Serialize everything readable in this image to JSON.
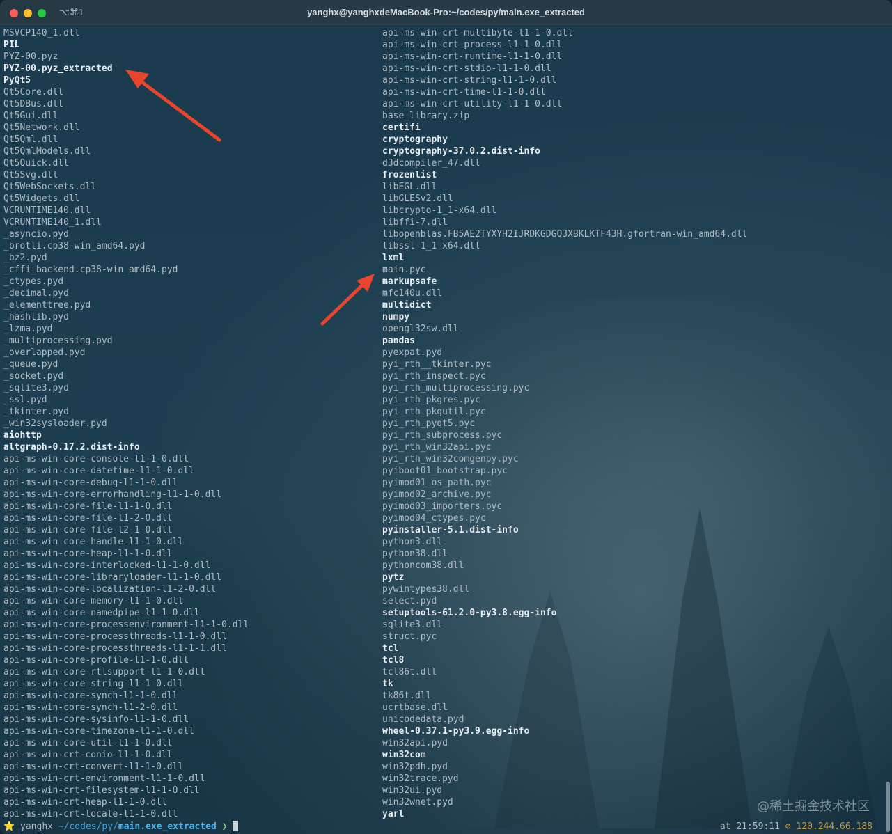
{
  "window": {
    "title": "yanghx@yanghxdeMacBook-Pro:~/codes/py/main.exe_extracted",
    "tab_shortcut": "⌥⌘1"
  },
  "listing": {
    "left_column": [
      {
        "name": "MSVCP140_1.dll",
        "dir": false
      },
      {
        "name": "PIL",
        "dir": true
      },
      {
        "name": "PYZ-00.pyz",
        "dir": false
      },
      {
        "name": "PYZ-00.pyz_extracted",
        "dir": true
      },
      {
        "name": "PyQt5",
        "dir": true
      },
      {
        "name": "Qt5Core.dll",
        "dir": false
      },
      {
        "name": "Qt5DBus.dll",
        "dir": false
      },
      {
        "name": "Qt5Gui.dll",
        "dir": false
      },
      {
        "name": "Qt5Network.dll",
        "dir": false
      },
      {
        "name": "Qt5Qml.dll",
        "dir": false
      },
      {
        "name": "Qt5QmlModels.dll",
        "dir": false
      },
      {
        "name": "Qt5Quick.dll",
        "dir": false
      },
      {
        "name": "Qt5Svg.dll",
        "dir": false
      },
      {
        "name": "Qt5WebSockets.dll",
        "dir": false
      },
      {
        "name": "Qt5Widgets.dll",
        "dir": false
      },
      {
        "name": "VCRUNTIME140.dll",
        "dir": false
      },
      {
        "name": "VCRUNTIME140_1.dll",
        "dir": false
      },
      {
        "name": "_asyncio.pyd",
        "dir": false
      },
      {
        "name": "_brotli.cp38-win_amd64.pyd",
        "dir": false
      },
      {
        "name": "_bz2.pyd",
        "dir": false
      },
      {
        "name": "_cffi_backend.cp38-win_amd64.pyd",
        "dir": false
      },
      {
        "name": "_ctypes.pyd",
        "dir": false
      },
      {
        "name": "_decimal.pyd",
        "dir": false
      },
      {
        "name": "_elementtree.pyd",
        "dir": false
      },
      {
        "name": "_hashlib.pyd",
        "dir": false
      },
      {
        "name": "_lzma.pyd",
        "dir": false
      },
      {
        "name": "_multiprocessing.pyd",
        "dir": false
      },
      {
        "name": "_overlapped.pyd",
        "dir": false
      },
      {
        "name": "_queue.pyd",
        "dir": false
      },
      {
        "name": "_socket.pyd",
        "dir": false
      },
      {
        "name": "_sqlite3.pyd",
        "dir": false
      },
      {
        "name": "_ssl.pyd",
        "dir": false
      },
      {
        "name": "_tkinter.pyd",
        "dir": false
      },
      {
        "name": "_win32sysloader.pyd",
        "dir": false
      },
      {
        "name": "aiohttp",
        "dir": true
      },
      {
        "name": "altgraph-0.17.2.dist-info",
        "dir": true
      },
      {
        "name": "api-ms-win-core-console-l1-1-0.dll",
        "dir": false
      },
      {
        "name": "api-ms-win-core-datetime-l1-1-0.dll",
        "dir": false
      },
      {
        "name": "api-ms-win-core-debug-l1-1-0.dll",
        "dir": false
      },
      {
        "name": "api-ms-win-core-errorhandling-l1-1-0.dll",
        "dir": false
      },
      {
        "name": "api-ms-win-core-file-l1-1-0.dll",
        "dir": false
      },
      {
        "name": "api-ms-win-core-file-l1-2-0.dll",
        "dir": false
      },
      {
        "name": "api-ms-win-core-file-l2-1-0.dll",
        "dir": false
      },
      {
        "name": "api-ms-win-core-handle-l1-1-0.dll",
        "dir": false
      },
      {
        "name": "api-ms-win-core-heap-l1-1-0.dll",
        "dir": false
      },
      {
        "name": "api-ms-win-core-interlocked-l1-1-0.dll",
        "dir": false
      },
      {
        "name": "api-ms-win-core-libraryloader-l1-1-0.dll",
        "dir": false
      },
      {
        "name": "api-ms-win-core-localization-l1-2-0.dll",
        "dir": false
      },
      {
        "name": "api-ms-win-core-memory-l1-1-0.dll",
        "dir": false
      },
      {
        "name": "api-ms-win-core-namedpipe-l1-1-0.dll",
        "dir": false
      },
      {
        "name": "api-ms-win-core-processenvironment-l1-1-0.dll",
        "dir": false
      },
      {
        "name": "api-ms-win-core-processthreads-l1-1-0.dll",
        "dir": false
      },
      {
        "name": "api-ms-win-core-processthreads-l1-1-1.dll",
        "dir": false
      },
      {
        "name": "api-ms-win-core-profile-l1-1-0.dll",
        "dir": false
      },
      {
        "name": "api-ms-win-core-rtlsupport-l1-1-0.dll",
        "dir": false
      },
      {
        "name": "api-ms-win-core-string-l1-1-0.dll",
        "dir": false
      },
      {
        "name": "api-ms-win-core-synch-l1-1-0.dll",
        "dir": false
      },
      {
        "name": "api-ms-win-core-synch-l1-2-0.dll",
        "dir": false
      },
      {
        "name": "api-ms-win-core-sysinfo-l1-1-0.dll",
        "dir": false
      },
      {
        "name": "api-ms-win-core-timezone-l1-1-0.dll",
        "dir": false
      },
      {
        "name": "api-ms-win-core-util-l1-1-0.dll",
        "dir": false
      },
      {
        "name": "api-ms-win-crt-conio-l1-1-0.dll",
        "dir": false
      },
      {
        "name": "api-ms-win-crt-convert-l1-1-0.dll",
        "dir": false
      },
      {
        "name": "api-ms-win-crt-environment-l1-1-0.dll",
        "dir": false
      },
      {
        "name": "api-ms-win-crt-filesystem-l1-1-0.dll",
        "dir": false
      },
      {
        "name": "api-ms-win-crt-heap-l1-1-0.dll",
        "dir": false
      },
      {
        "name": "api-ms-win-crt-locale-l1-1-0.dll",
        "dir": false
      }
    ],
    "right_column": [
      {
        "name": "api-ms-win-crt-multibyte-l1-1-0.dll",
        "dir": false
      },
      {
        "name": "api-ms-win-crt-process-l1-1-0.dll",
        "dir": false
      },
      {
        "name": "api-ms-win-crt-runtime-l1-1-0.dll",
        "dir": false
      },
      {
        "name": "api-ms-win-crt-stdio-l1-1-0.dll",
        "dir": false
      },
      {
        "name": "api-ms-win-crt-string-l1-1-0.dll",
        "dir": false
      },
      {
        "name": "api-ms-win-crt-time-l1-1-0.dll",
        "dir": false
      },
      {
        "name": "api-ms-win-crt-utility-l1-1-0.dll",
        "dir": false
      },
      {
        "name": "base_library.zip",
        "dir": false
      },
      {
        "name": "certifi",
        "dir": true
      },
      {
        "name": "cryptography",
        "dir": true
      },
      {
        "name": "cryptography-37.0.2.dist-info",
        "dir": true
      },
      {
        "name": "d3dcompiler_47.dll",
        "dir": false
      },
      {
        "name": "frozenlist",
        "dir": true
      },
      {
        "name": "libEGL.dll",
        "dir": false
      },
      {
        "name": "libGLESv2.dll",
        "dir": false
      },
      {
        "name": "libcrypto-1_1-x64.dll",
        "dir": false
      },
      {
        "name": "libffi-7.dll",
        "dir": false
      },
      {
        "name": "libopenblas.FB5AE2TYXYH2IJRDKGDGQ3XBKLKTF43H.gfortran-win_amd64.dll",
        "dir": false
      },
      {
        "name": "libssl-1_1-x64.dll",
        "dir": false
      },
      {
        "name": "lxml",
        "dir": true
      },
      {
        "name": "main.pyc",
        "dir": false
      },
      {
        "name": "markupsafe",
        "dir": true
      },
      {
        "name": "mfc140u.dll",
        "dir": false
      },
      {
        "name": "multidict",
        "dir": true
      },
      {
        "name": "numpy",
        "dir": true
      },
      {
        "name": "opengl32sw.dll",
        "dir": false
      },
      {
        "name": "pandas",
        "dir": true
      },
      {
        "name": "pyexpat.pyd",
        "dir": false
      },
      {
        "name": "pyi_rth__tkinter.pyc",
        "dir": false
      },
      {
        "name": "pyi_rth_inspect.pyc",
        "dir": false
      },
      {
        "name": "pyi_rth_multiprocessing.pyc",
        "dir": false
      },
      {
        "name": "pyi_rth_pkgres.pyc",
        "dir": false
      },
      {
        "name": "pyi_rth_pkgutil.pyc",
        "dir": false
      },
      {
        "name": "pyi_rth_pyqt5.pyc",
        "dir": false
      },
      {
        "name": "pyi_rth_subprocess.pyc",
        "dir": false
      },
      {
        "name": "pyi_rth_win32api.pyc",
        "dir": false
      },
      {
        "name": "pyi_rth_win32comgenpy.pyc",
        "dir": false
      },
      {
        "name": "pyiboot01_bootstrap.pyc",
        "dir": false
      },
      {
        "name": "pyimod01_os_path.pyc",
        "dir": false
      },
      {
        "name": "pyimod02_archive.pyc",
        "dir": false
      },
      {
        "name": "pyimod03_importers.pyc",
        "dir": false
      },
      {
        "name": "pyimod04_ctypes.pyc",
        "dir": false
      },
      {
        "name": "pyinstaller-5.1.dist-info",
        "dir": true
      },
      {
        "name": "python3.dll",
        "dir": false
      },
      {
        "name": "python38.dll",
        "dir": false
      },
      {
        "name": "pythoncom38.dll",
        "dir": false
      },
      {
        "name": "pytz",
        "dir": true
      },
      {
        "name": "pywintypes38.dll",
        "dir": false
      },
      {
        "name": "select.pyd",
        "dir": false
      },
      {
        "name": "setuptools-61.2.0-py3.8.egg-info",
        "dir": true
      },
      {
        "name": "sqlite3.dll",
        "dir": false
      },
      {
        "name": "struct.pyc",
        "dir": false
      },
      {
        "name": "tcl",
        "dir": true
      },
      {
        "name": "tcl8",
        "dir": true
      },
      {
        "name": "tcl86t.dll",
        "dir": false
      },
      {
        "name": "tk",
        "dir": true
      },
      {
        "name": "tk86t.dll",
        "dir": false
      },
      {
        "name": "ucrtbase.dll",
        "dir": false
      },
      {
        "name": "unicodedata.pyd",
        "dir": false
      },
      {
        "name": "wheel-0.37.1-py3.9.egg-info",
        "dir": true
      },
      {
        "name": "win32api.pyd",
        "dir": false
      },
      {
        "name": "win32com",
        "dir": true
      },
      {
        "name": "win32pdh.pyd",
        "dir": false
      },
      {
        "name": "win32trace.pyd",
        "dir": false
      },
      {
        "name": "win32ui.pyd",
        "dir": false
      },
      {
        "name": "win32wnet.pyd",
        "dir": false
      },
      {
        "name": "yarl",
        "dir": true
      }
    ]
  },
  "prompt": {
    "star": "⭐",
    "user": "yanghx",
    "path_prefix": "~/codes/py/",
    "path_current": "main.exe_extracted",
    "chevron": "❯"
  },
  "rprompt": {
    "at": "at 21:59:11",
    "icon": "⊘",
    "ip": "120.244.66.188"
  },
  "watermark": "@稀土掘金技术社区",
  "colors": {
    "background": "#1b3d4f",
    "file_text": "#aebcc5",
    "dir_text": "#e7edf1",
    "path_blue": "#4bb4ec",
    "chevron_green": "#7fd36b",
    "ip_orange": "#c79a3a",
    "annotation_arrow": "#e8452c"
  }
}
